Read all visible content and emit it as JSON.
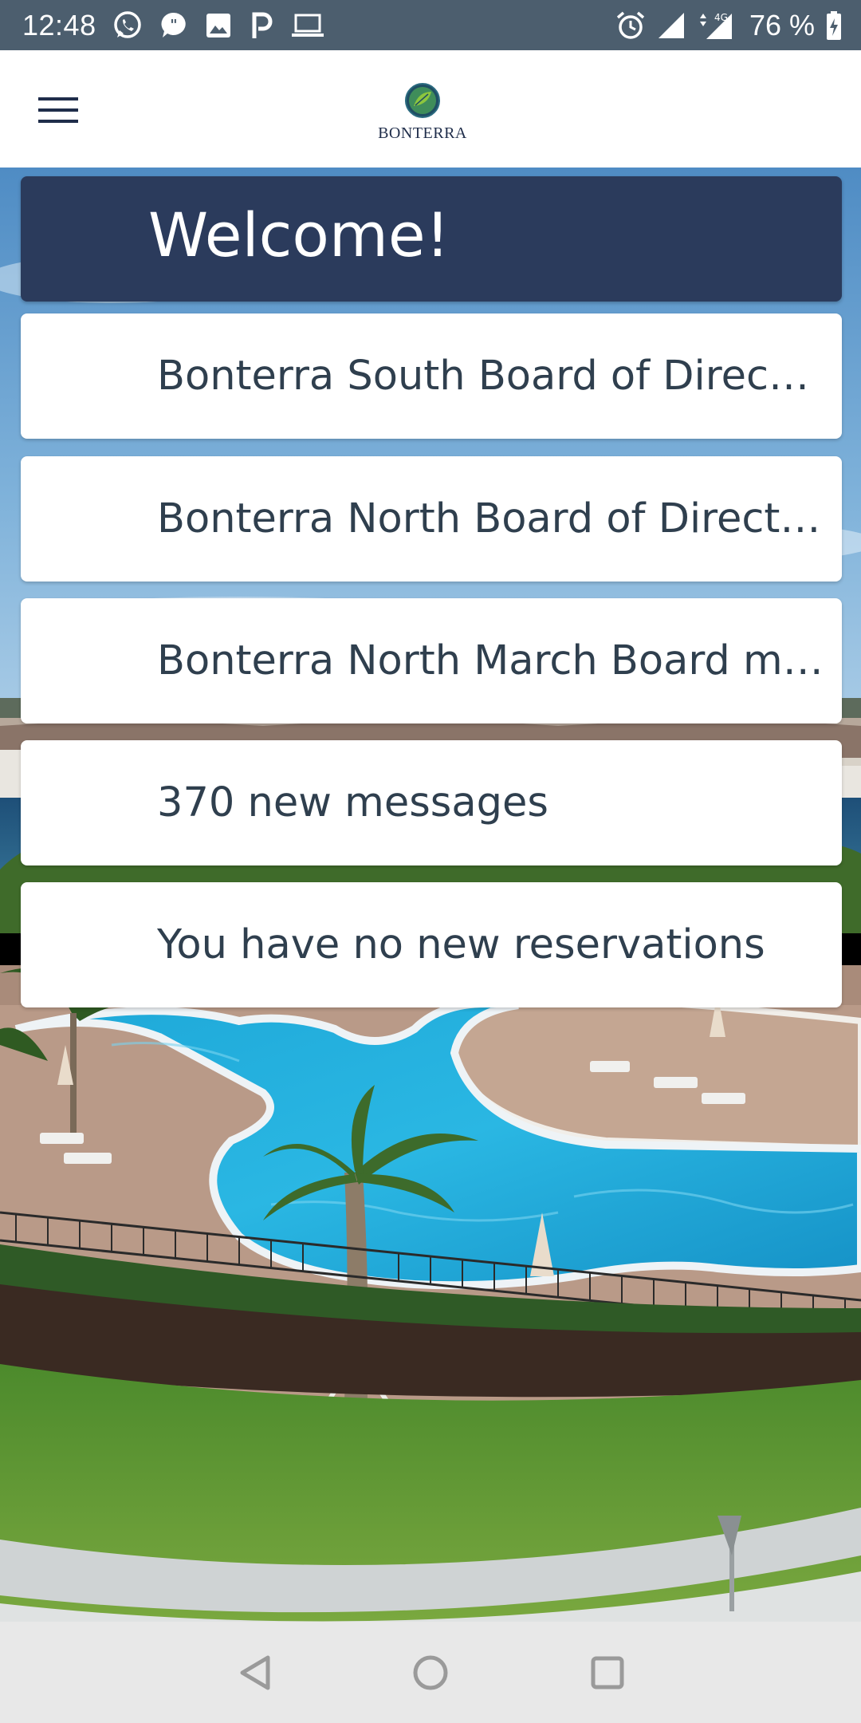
{
  "status_bar": {
    "time": "12:48",
    "left_icons": [
      "whatsapp-icon",
      "message-quote-icon",
      "image-icon",
      "parking-icon",
      "laptop-icon"
    ],
    "right_icons": [
      "alarm-icon",
      "signal-icon",
      "4g-data-icon",
      "signal-icon",
      "battery-charging-icon"
    ],
    "network_label": "4G",
    "battery_percent": "76 %"
  },
  "header": {
    "menu_icon": "hamburger-menu-icon",
    "logo_text": "BONTERRA"
  },
  "welcome": {
    "title": "Welcome!"
  },
  "cards": [
    {
      "text": "Bonterra South Board of Directors Meeting"
    },
    {
      "text": "Bonterra North Board of Directors Meeting"
    },
    {
      "text": "Bonterra North March Board meeting"
    },
    {
      "text": "370 new messages"
    },
    {
      "text": "You have no new reservations"
    }
  ],
  "nav_bar": {
    "buttons": [
      "back-triangle-icon",
      "home-circle-icon",
      "recents-square-icon"
    ]
  },
  "colors": {
    "status_bar": "#4c5e6e",
    "welcome_banner": "#2b3b5c",
    "card_text": "#2f3f4e",
    "nav_bar": "#e8e8e8"
  }
}
